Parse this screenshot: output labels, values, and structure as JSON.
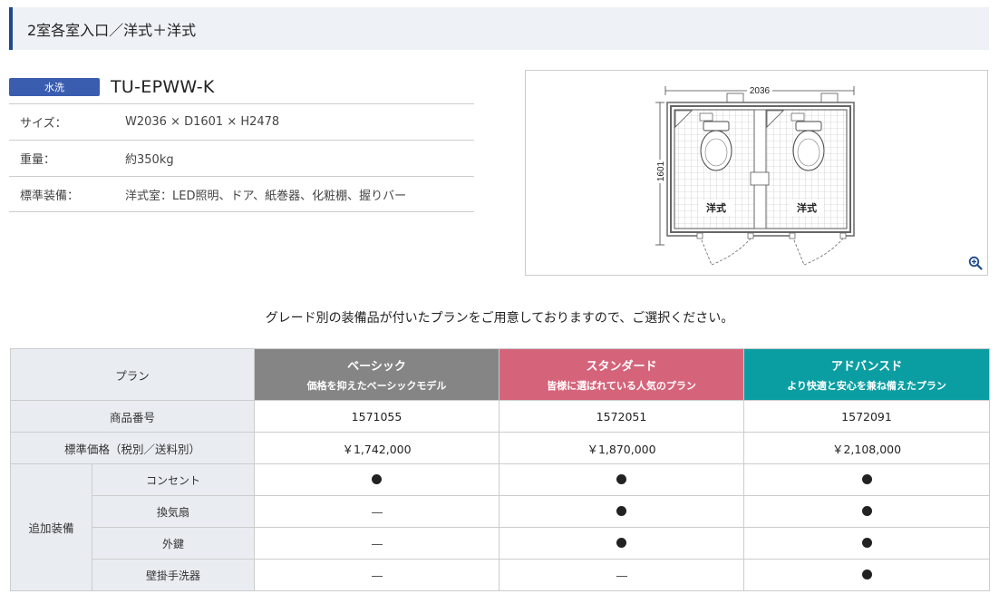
{
  "section": {
    "title": "2室各室入口／洋式＋洋式"
  },
  "product": {
    "badge": "水洗",
    "model": "TU-EPWW-K",
    "specs": [
      {
        "label": "サイズ：",
        "value": "W2036 × D1601 × H2478"
      },
      {
        "label": "重量：",
        "value": "約350kg"
      },
      {
        "label": "標準装備：",
        "value": "洋式室：LED照明、ドア、紙巻器、化粧棚、握りバー"
      }
    ]
  },
  "diagram": {
    "width_label": "2036",
    "depth_label": "1601",
    "room_left_label": "洋式",
    "room_right_label": "洋式",
    "zoom_icon": "zoom-in-icon"
  },
  "lead_text": "グレード別の装備品が付いたプランをご用意しておりますので、ご選択ください。",
  "table": {
    "plan_header": "プラン",
    "plans": [
      {
        "name": "ベーシック",
        "desc": "価格を抑えたベーシックモデル",
        "color": "#858585"
      },
      {
        "name": "スタンダード",
        "desc": "皆様に選ばれている人気のプラン",
        "color": "#d5647b"
      },
      {
        "name": "アドバンスド",
        "desc": "より快適と安心を兼ね備えたプラン",
        "color": "#0a9ea2"
      }
    ],
    "product_no_label": "商品番号",
    "product_nos": [
      "1571055",
      "1572051",
      "1572091"
    ],
    "price_label": "標準価格（税別／送料別）",
    "prices": [
      "￥1,742,000",
      "￥1,870,000",
      "￥2,108,000"
    ],
    "options_label": "追加装備",
    "options": [
      {
        "name": "コンセント",
        "included": [
          true,
          true,
          true
        ]
      },
      {
        "name": "換気扇",
        "included": [
          false,
          true,
          true
        ]
      },
      {
        "name": "外鍵",
        "included": [
          false,
          true,
          true
        ]
      },
      {
        "name": "壁掛手洗器",
        "included": [
          false,
          false,
          true
        ]
      }
    ]
  }
}
